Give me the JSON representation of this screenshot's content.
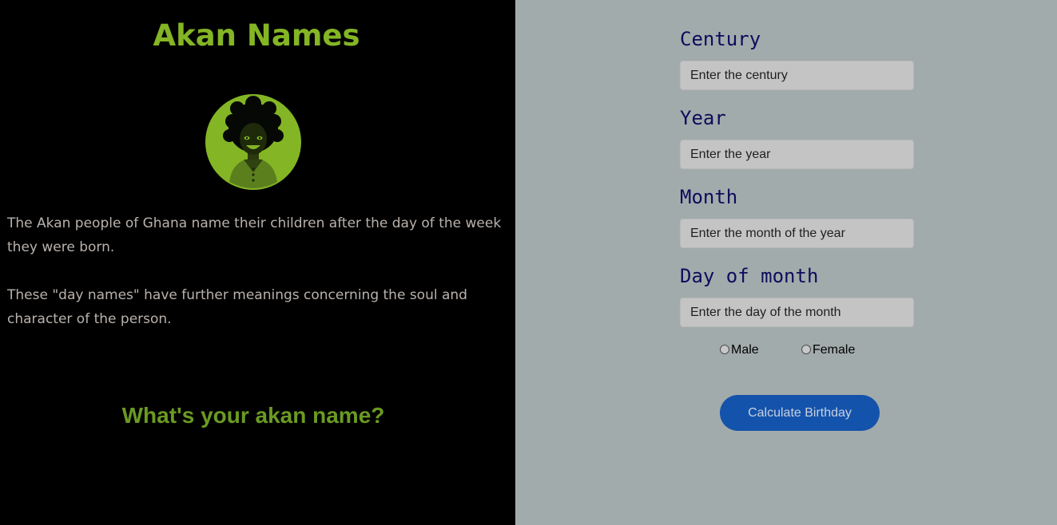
{
  "info": {
    "title": "Akan Names",
    "avatar": "woman-avatar-illustration",
    "paragraph1": "The Akan people of Ghana name their children after the day of the week they were born.",
    "paragraph2": "These \"day names\" have further meanings concerning the soul and character of the person.",
    "question": "What's your akan name?"
  },
  "form": {
    "century": {
      "label": "Century",
      "placeholder": "Enter the century",
      "value": ""
    },
    "year": {
      "label": "Year",
      "placeholder": "Enter the year",
      "value": ""
    },
    "month": {
      "label": "Month",
      "placeholder": "Enter the month of the year",
      "value": ""
    },
    "day": {
      "label": "Day of month",
      "placeholder": "Enter the day of the month",
      "value": ""
    },
    "gender": {
      "options": [
        {
          "label": "Male",
          "checked": false
        },
        {
          "label": "Female",
          "checked": false
        }
      ]
    },
    "submit_label": "Calculate Birthday"
  },
  "colors": {
    "left_background": "#000000",
    "right_background": "#a2abab",
    "title_green": "#84b525",
    "question_green": "#6b9a22",
    "label_navy": "#0b0d5c",
    "button_blue": "#1453ab"
  }
}
